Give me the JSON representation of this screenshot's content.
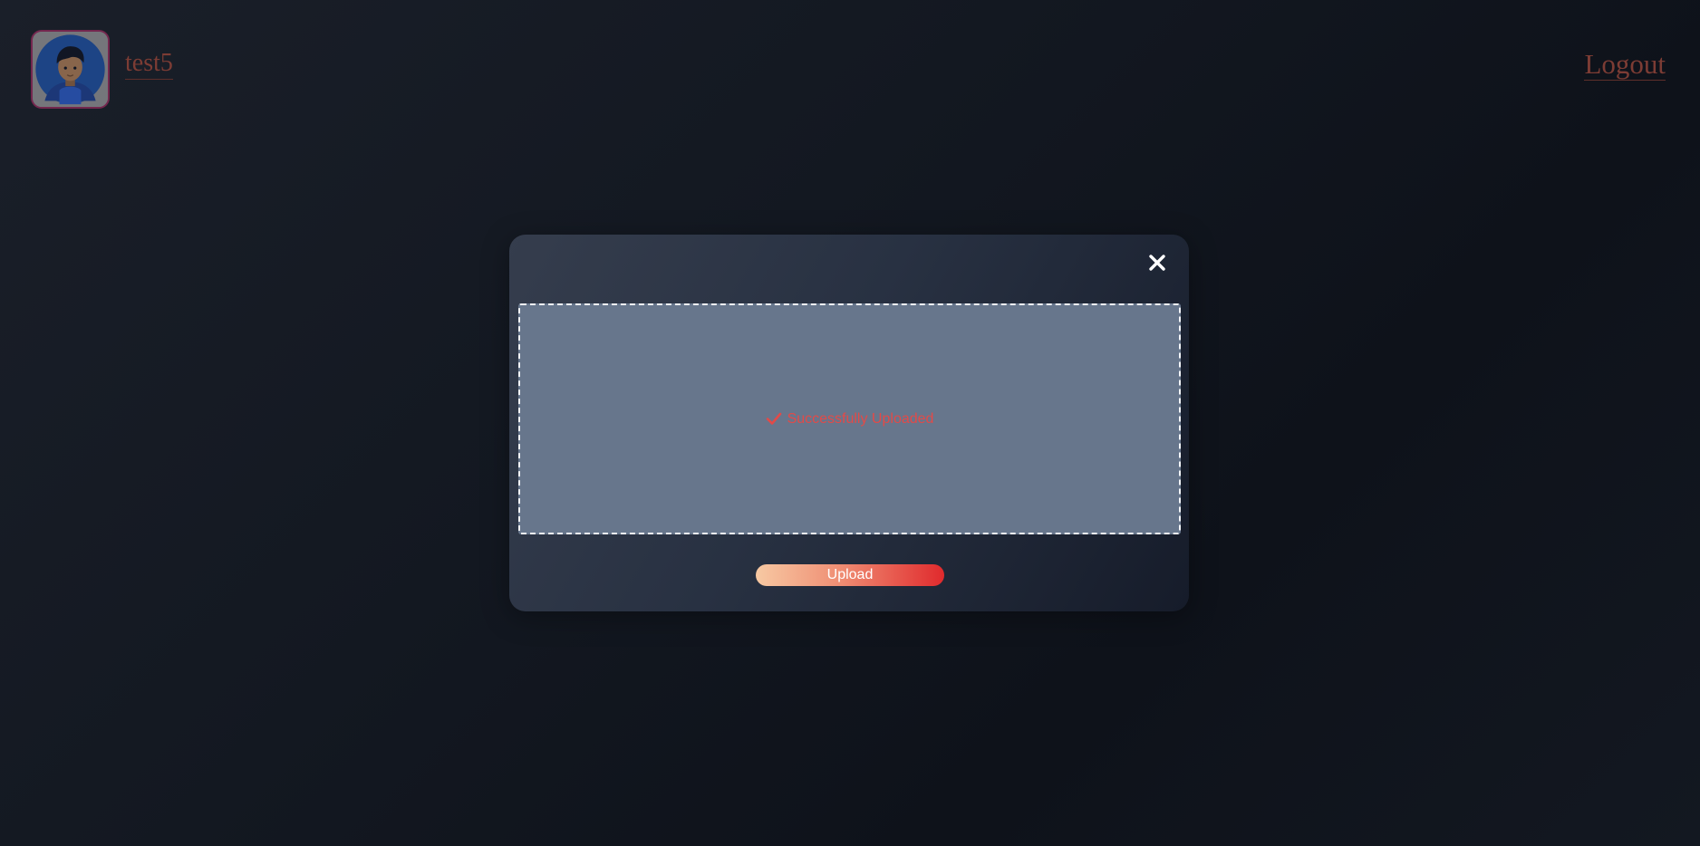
{
  "header": {
    "username": "test5",
    "logout_label": "Logout",
    "avatar_icon": "user-avatar-icon"
  },
  "modal": {
    "close_icon": "close-icon",
    "dropzone": {
      "status_icon": "checkmark-icon",
      "status_text": "Successfully Uploaded"
    },
    "upload_label": "Upload"
  },
  "colors": {
    "accent_gradient_start": "#f7c9a3",
    "accent_gradient_end": "#e02a2d",
    "status_text": "#e24a48",
    "dropzone_bg": "#67768c",
    "link_text": "#7c3c34",
    "avatar_border": "#8e2a5a"
  }
}
